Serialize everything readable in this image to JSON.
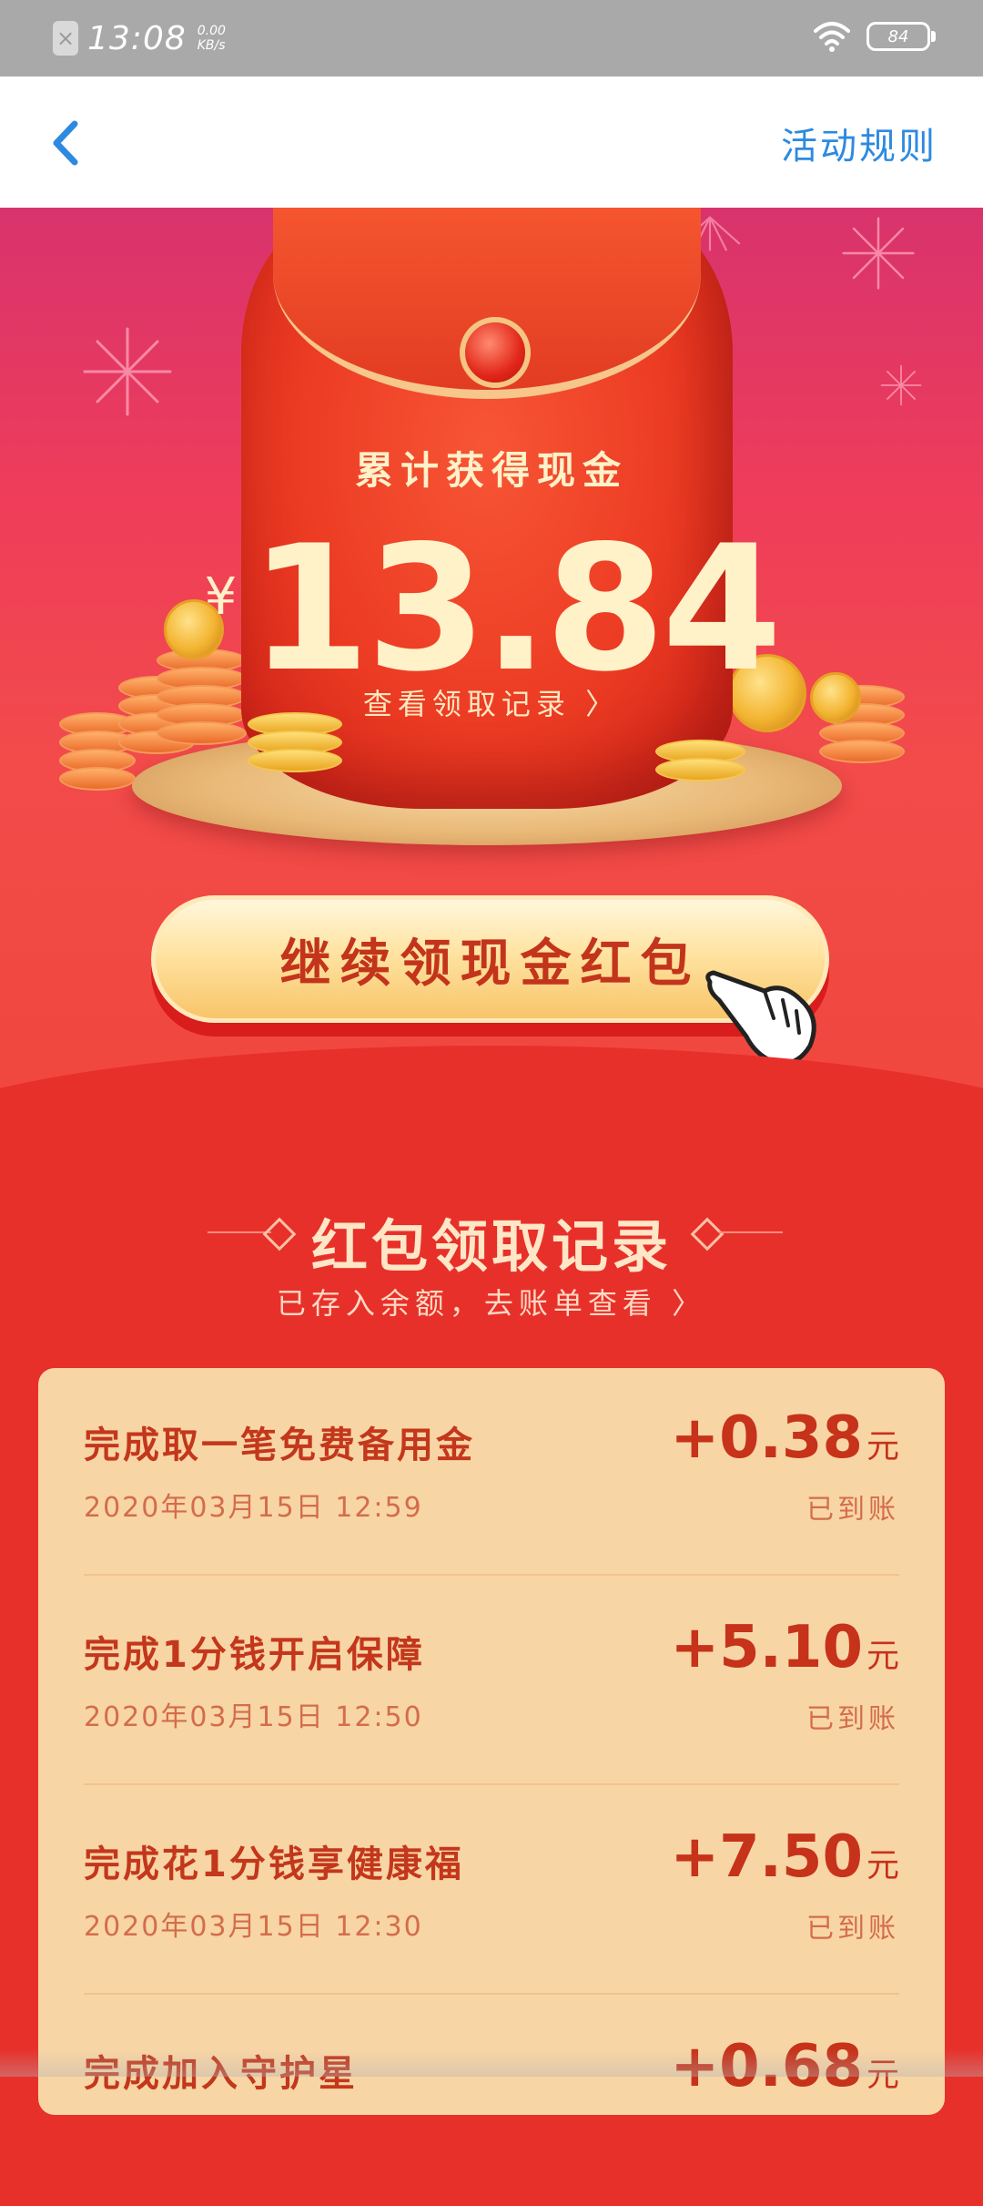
{
  "status_bar": {
    "time": "13:08",
    "speed_value": "0.00",
    "speed_unit": "KB/s",
    "battery": "84"
  },
  "nav": {
    "back_icon": "chevron-left-icon",
    "rules_label": "活动规则"
  },
  "hero": {
    "label": "累计获得现金",
    "currency": "¥",
    "amount": "13.84",
    "view_records": "查看领取记录 〉"
  },
  "cta": {
    "label": "继续领现金红包",
    "hand_icon": "pointing-hand-icon"
  },
  "section": {
    "title": "红包领取记录",
    "subtitle": "已存入余额，去账单查看 〉"
  },
  "records": [
    {
      "title": "完成取一笔免费备用金",
      "time": "2020年03月15日  12:59",
      "amount": "+0.38",
      "unit": "元",
      "status": "已到账"
    },
    {
      "title": "完成1分钱开启保障",
      "time": "2020年03月15日  12:50",
      "amount": "+5.10",
      "unit": "元",
      "status": "已到账"
    },
    {
      "title": "完成花1分钱享健康福",
      "time": "2020年03月15日  12:30",
      "amount": "+7.50",
      "unit": "元",
      "status": "已到账"
    },
    {
      "title": "完成加入守护星",
      "time": "",
      "amount": "+0.68",
      "unit": "元",
      "status": ""
    }
  ],
  "colors": {
    "accent_red": "#e8302a",
    "link_blue": "#2d8ae0",
    "card_bg": "#f8d5a5",
    "amount_text": "#c6321a"
  }
}
